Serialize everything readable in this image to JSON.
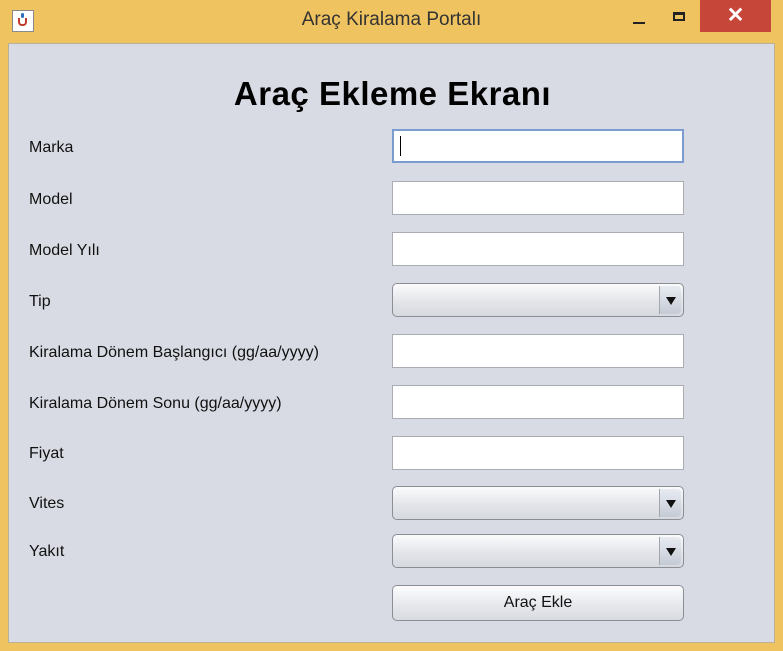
{
  "window": {
    "title": "Araç Kiralama Portalı",
    "controls": {
      "minimize": "minimize",
      "maximize": "maximize",
      "close": "✕"
    }
  },
  "form": {
    "heading": "Araç Ekleme Ekranı",
    "fields": {
      "marka": {
        "label": "Marka",
        "value": ""
      },
      "model": {
        "label": "Model",
        "value": ""
      },
      "model_yili": {
        "label": "Model Yılı",
        "value": ""
      },
      "tip": {
        "label": "Tip",
        "selected": ""
      },
      "baslangic": {
        "label": "Kiralama Dönem Başlangıcı (gg/aa/yyyy)",
        "value": ""
      },
      "sonu": {
        "label": "Kiralama Dönem Sonu (gg/aa/yyyy)",
        "value": ""
      },
      "fiyat": {
        "label": "Fiyat",
        "value": ""
      },
      "vites": {
        "label": "Vites",
        "selected": ""
      },
      "yakit": {
        "label": "Yakıt",
        "selected": ""
      }
    },
    "submit_label": "Araç Ekle"
  },
  "colors": {
    "titlebar": "#efc460",
    "close_button": "#c7463a",
    "panel": "#d8dbe3"
  }
}
